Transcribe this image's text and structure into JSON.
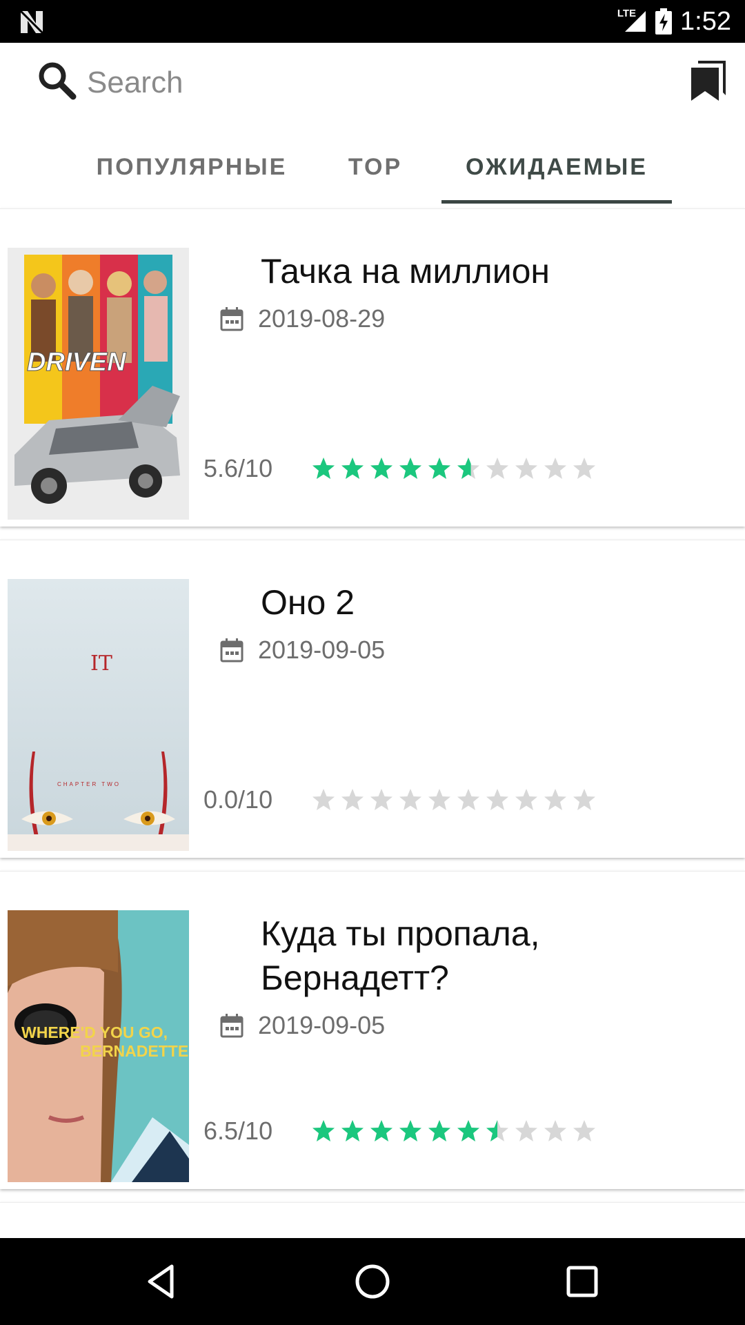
{
  "status_bar": {
    "network": "LTE",
    "time": "1:52"
  },
  "search": {
    "placeholder": "Search"
  },
  "tabs": [
    {
      "label": "ПОПУЛЯРНЫЕ"
    },
    {
      "label": "TOP"
    },
    {
      "label": "ОЖИДАЕМЫЕ",
      "active": true
    }
  ],
  "movies": [
    {
      "title": "Тачка на миллион",
      "date": "2019-08-29",
      "rating": "5.6/10",
      "score": 5.6,
      "poster_text": "DRIVEN",
      "poster_icon": "driven-poster-image"
    },
    {
      "title": "Оно 2",
      "date": "2019-09-05",
      "rating": "0.0/10",
      "score": 0.0,
      "poster_text": "IT",
      "poster_subtext": "CHAPTER TWO",
      "poster_icon": "it-chapter-two-poster-image"
    },
    {
      "title": "Куда ты пропала, Бернадетт?",
      "date": "2019-09-05",
      "rating": "6.5/10",
      "score": 6.5,
      "poster_text": "WHERE'D YOU GO,",
      "poster_text2": "BERNADETTE",
      "poster_icon": "bernadette-poster-image"
    }
  ],
  "colors": {
    "star_filled": "#1bc77e",
    "star_empty": "#d7d7d7",
    "tab_active": "#3a4643"
  },
  "icons": [
    "search-icon",
    "bookmark-icon",
    "calendar-icon",
    "star-icon",
    "back-icon",
    "home-icon",
    "recents-icon"
  ]
}
